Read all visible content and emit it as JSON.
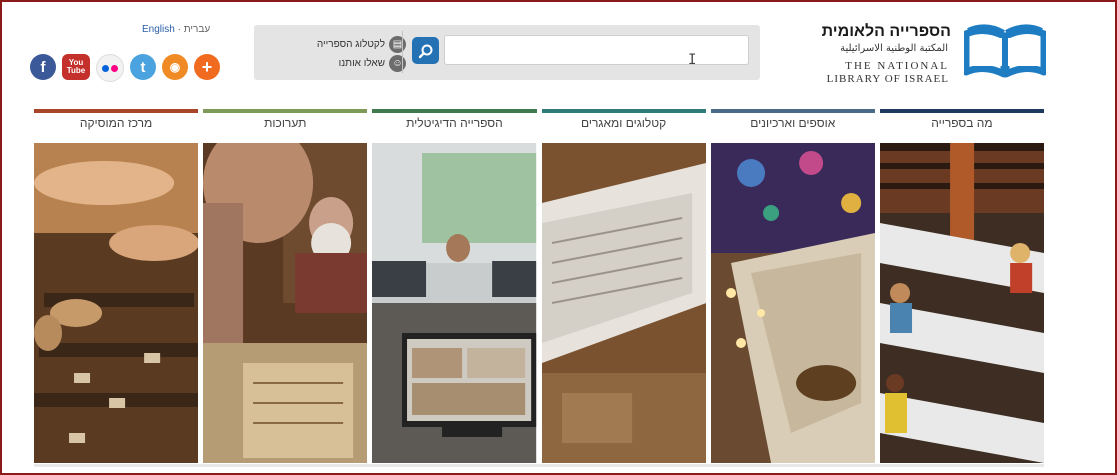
{
  "header": {
    "lang_english": "English",
    "lang_hebrew": "עברית",
    "lang_separator": "·",
    "logo_hebrew": "הספרייה הלאומית",
    "logo_arabic": "المكتبة الوطنية الاسرائيلية",
    "logo_en_line1": "THE NATIONAL",
    "logo_en_line2": "LIBRARY OF ISRAEL"
  },
  "search": {
    "placeholder": "",
    "value": "",
    "link_catalog": "לקטלוג הספרייה",
    "link_ask": "שאלו אותנו"
  },
  "social": [
    "facebook-icon",
    "youtube-icon",
    "flickr-icon",
    "twitter-icon",
    "rss-icon",
    "addthis-icon"
  ],
  "social_labels": {
    "youtube": "You Tube"
  },
  "nav": {
    "items": [
      {
        "label": "מה בספרייה",
        "color": "#1f3a5f"
      },
      {
        "label": "אוספים וארכיונים",
        "color": "#4a6a8a"
      },
      {
        "label": "קטלוגים ומאגרים",
        "color": "#2e7b7a"
      },
      {
        "label": "הספרייה הדיגיטלית",
        "color": "#3e7a4e"
      },
      {
        "label": "תערוכות",
        "color": "#7e9a58"
      },
      {
        "label": "מרכז המוסיקה",
        "color": "#a8442a"
      }
    ]
  },
  "images": [
    {
      "name": "reading-room-photo"
    },
    {
      "name": "archives-photo"
    },
    {
      "name": "newspapers-photo"
    },
    {
      "name": "digital-library-photo"
    },
    {
      "name": "exhibitions-photo"
    },
    {
      "name": "music-center-photo"
    }
  ],
  "colors": {
    "frame": "#8b1a1a",
    "search_button": "#2471b4",
    "logo_blue": "#1d7cc2"
  }
}
